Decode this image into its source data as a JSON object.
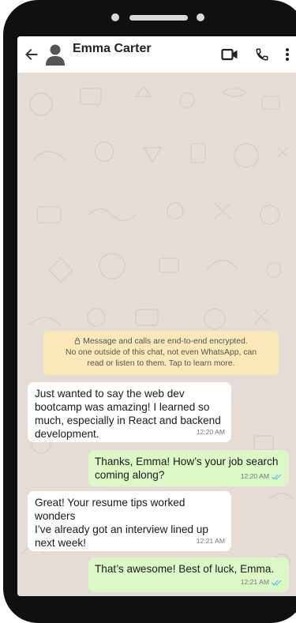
{
  "header": {
    "contact_name": "Emma Carter",
    "back_icon": "arrow-left-icon",
    "avatar_icon": "person-silhouette-icon",
    "video_icon": "video-camera-icon",
    "call_icon": "phone-icon",
    "menu_icon": "vertical-dots-icon"
  },
  "chat": {
    "encryption_notice": {
      "icon": "lock-icon",
      "line1": "Message and calls are end-to-end encrypted.",
      "line2": "No one outside of this chat, not even WhatsApp, can",
      "line3": "read or listen to them. Tap to learn more."
    },
    "messages": [
      {
        "direction": "incoming",
        "text": "Just wanted to say the web dev\nbootcamp was amazing! I learned so\nmuch, especially in React and backend\ndevelopment.",
        "time": "12:20 AM"
      },
      {
        "direction": "outgoing",
        "text": "Thanks, Emma! How’s your job search\ncoming along?",
        "time": "12:20 AM",
        "status_icon": "double-check-icon"
      },
      {
        "direction": "incoming",
        "text": "Great! Your resume tips worked\nwonders\nI’ve already got an interview lined up\nnext week!",
        "time": "12:21 AM"
      },
      {
        "direction": "outgoing",
        "text": "That’s awesome! Best of luck, Emma.",
        "time": "12:21 AM",
        "status_icon": "double-check-icon"
      }
    ]
  },
  "colors": {
    "header_bg": "#ffffff",
    "chat_bg": "#e5ddd5",
    "incoming_bubble": "#ffffff",
    "outgoing_bubble": "#dcf8c6",
    "encryption_bg": "#fae8b8",
    "tick_color": "#53bdeb",
    "phone_frame": "#101010"
  }
}
